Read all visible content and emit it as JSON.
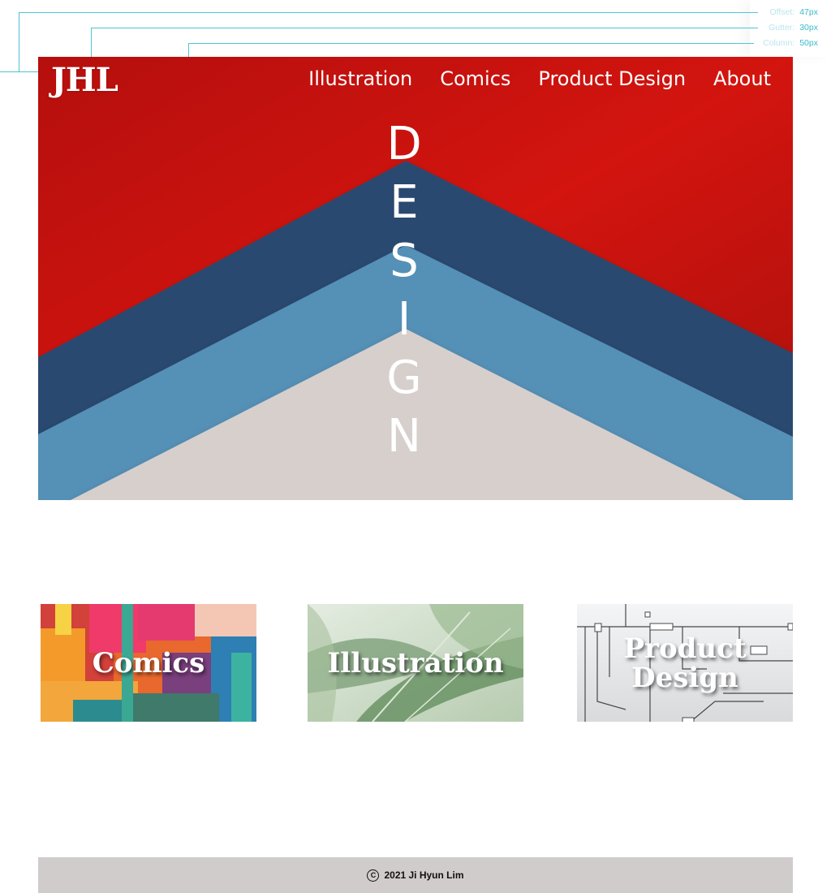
{
  "guides": {
    "rows": [
      {
        "label": "Offset:",
        "value": "47px"
      },
      {
        "label": "Gutter:",
        "value": "30px"
      },
      {
        "label": "Column:",
        "value": "50px"
      }
    ]
  },
  "header": {
    "logo": "JHL",
    "nav": [
      "Illustration",
      "Comics",
      "Product Design",
      "About"
    ]
  },
  "hero": {
    "letters": [
      "D",
      "E",
      "S",
      "I",
      "G",
      "N"
    ]
  },
  "cards": [
    {
      "label": "Comics"
    },
    {
      "label": "Illustration"
    },
    {
      "label": "Product Design"
    }
  ],
  "footer": {
    "text": "2021 Ji Hyun Lim"
  },
  "colors": {
    "hero_red": "#c8130f",
    "navy": "#2a4a70",
    "steel_blue": "#5590b6",
    "paper": "#d6cfcc",
    "guide_cyan": "#4ec5d3",
    "footer_bg": "#d0cccb"
  }
}
